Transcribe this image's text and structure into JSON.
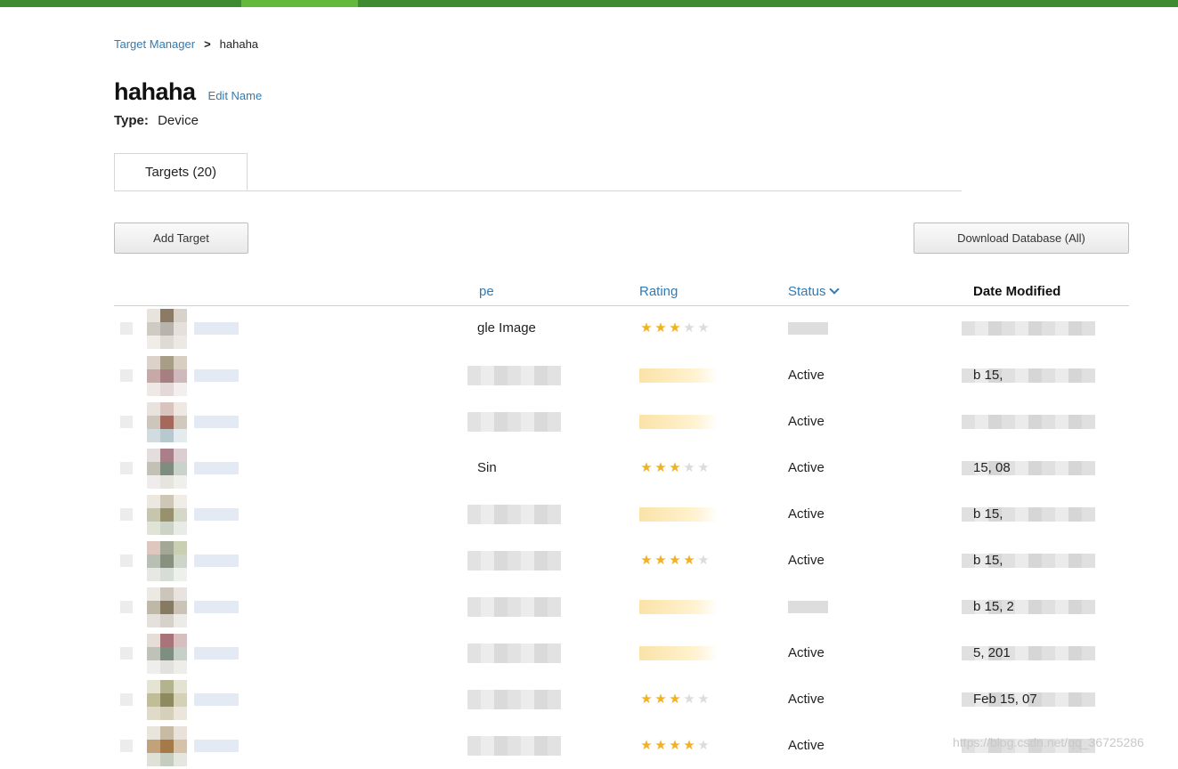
{
  "breadcrumb": {
    "root": "Target Manager",
    "separator": ">",
    "current": "hahaha"
  },
  "page": {
    "title": "hahaha",
    "edit_label": "Edit Name",
    "type_label": "Type:",
    "type_value": "Device"
  },
  "tabs": [
    {
      "label": "Targets (20)",
      "active": true
    }
  ],
  "toolbar": {
    "add_label": "Add Target",
    "download_label": "Download Database (All)"
  },
  "table": {
    "columns": {
      "type": "pe",
      "rating": "Rating",
      "status": "Status",
      "date": "Date Modified"
    },
    "sort": {
      "column": "Status",
      "direction": "descending"
    },
    "rows": [
      {
        "type": "gle Image",
        "rating": 3,
        "status": "",
        "date": ""
      },
      {
        "type": "",
        "rating": null,
        "status": "Active",
        "date": "b 15,"
      },
      {
        "type": "",
        "rating": null,
        "status": "Active",
        "date": ""
      },
      {
        "type": "Sin",
        "rating": 3,
        "status": "Active",
        "date": "15, 08"
      },
      {
        "type": "",
        "rating": null,
        "status": "Active",
        "date": "b 15,"
      },
      {
        "type": "",
        "rating": 4,
        "status": "Active",
        "date": "b 15,"
      },
      {
        "type": "",
        "rating": null,
        "status": "",
        "date": "b 15, 2"
      },
      {
        "type": "",
        "rating": null,
        "status": "Active",
        "date": "5, 201"
      },
      {
        "type": "",
        "rating": 3,
        "status": "Active",
        "date": "Feb 15, 07"
      },
      {
        "type": "",
        "rating": 4,
        "status": "Active",
        "date": ""
      }
    ]
  },
  "watermark": "https://blog.csdn.net/qq_36725286",
  "colors": {
    "link": "#2f7bb6",
    "star": "#f2b11e",
    "brand_bar": "#3f8b2f"
  }
}
